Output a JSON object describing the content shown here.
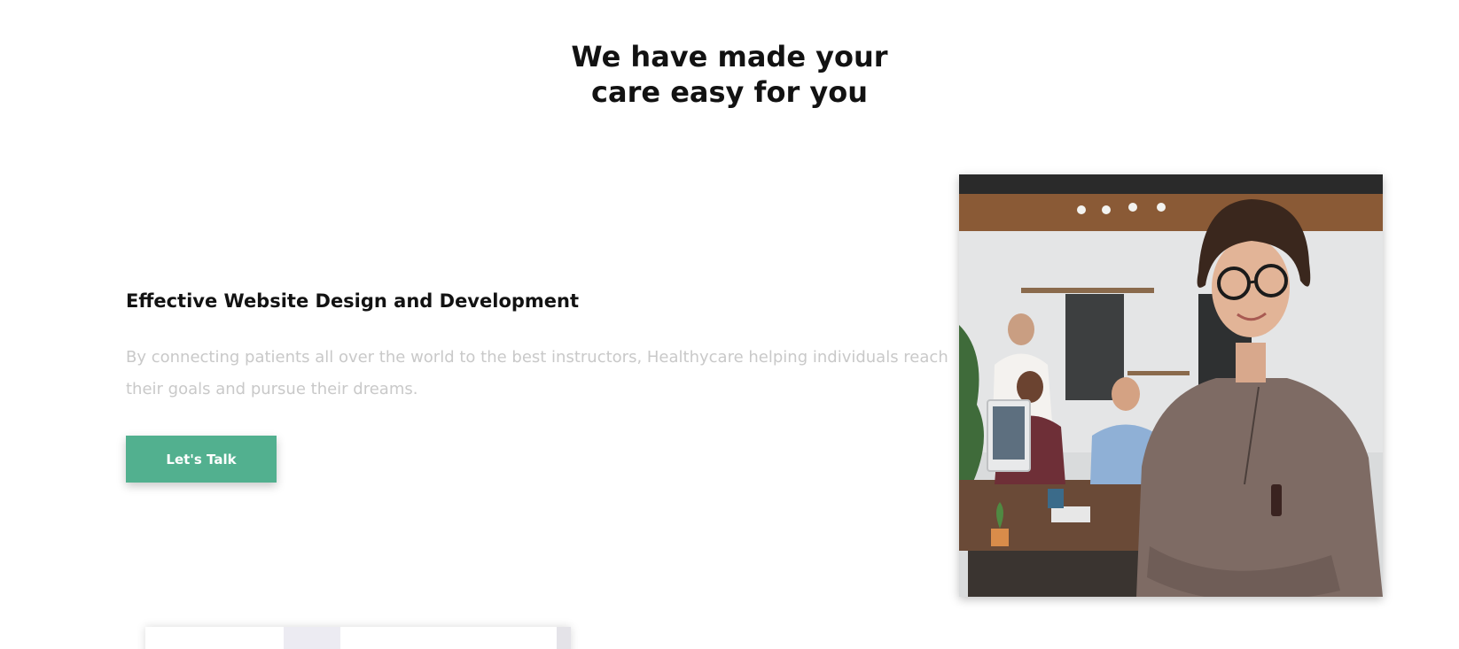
{
  "section": {
    "title_line1": "We have made your",
    "title_line2": "care easy for you"
  },
  "feature": {
    "heading": "Effective Website Design and Development",
    "description": "By connecting patients all over the world to the best instructors, Healthycare helping individuals reach their goals and pursue their dreams.",
    "cta_label": "Let's Talk",
    "image_subject": "smiling woman with glasses, arms crossed, colleagues working in an office behind her"
  },
  "colors": {
    "accent": "#52b08f",
    "heading": "#121212",
    "muted_text": "#c9c9c9"
  }
}
